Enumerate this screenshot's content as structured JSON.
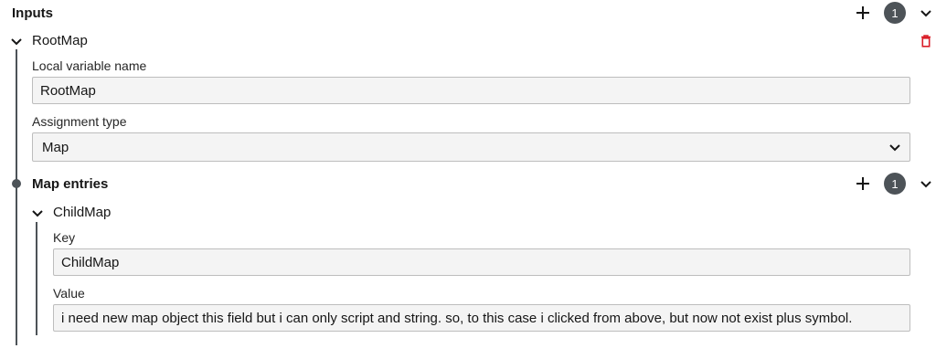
{
  "inputs": {
    "title": "Inputs",
    "count": "1"
  },
  "root_map": {
    "name": "RootMap",
    "local_variable_label": "Local variable name",
    "local_variable_value": "RootMap",
    "assignment_type_label": "Assignment type",
    "assignment_type_value": "Map"
  },
  "map_entries": {
    "title": "Map entries",
    "count": "1",
    "entry": {
      "name": "ChildMap",
      "key_label": "Key",
      "key_value": "ChildMap",
      "value_label": "Value",
      "value_value": "i need new map object this field but i can only script and string. so, to this case i clicked from above, but now not exist plus symbol."
    }
  },
  "colors": {
    "delete": "#da1e28",
    "badge": "#4d5358",
    "line": "#4d5358"
  }
}
